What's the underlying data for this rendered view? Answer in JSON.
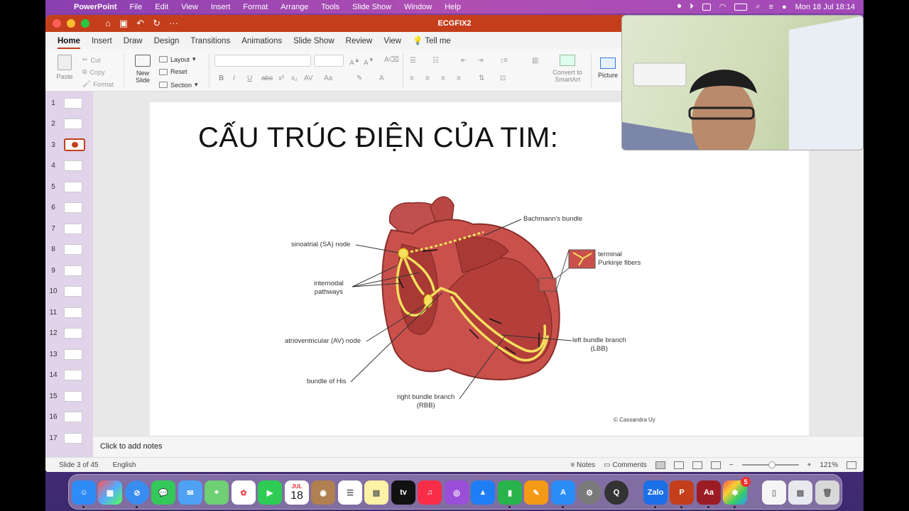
{
  "menubar": {
    "app_name": "PowerPoint",
    "items": [
      "File",
      "Edit",
      "View",
      "Insert",
      "Format",
      "Arrange",
      "Tools",
      "Slide Show",
      "Window",
      "Help"
    ],
    "clock": "Mon 18 Jul  18:14"
  },
  "window": {
    "title": "ECGFIX2",
    "tabs": [
      "Home",
      "Insert",
      "Draw",
      "Design",
      "Transitions",
      "Animations",
      "Slide Show",
      "Review",
      "View"
    ],
    "active_tab": "Home",
    "tell_me": "Tell me"
  },
  "ribbon": {
    "paste": "Paste",
    "cut": "Cut",
    "copy": "Copy",
    "format": "Format",
    "new_slide": "New\nSlide",
    "layout": "Layout",
    "reset": "Reset",
    "section": "Section",
    "convert_smartart": "Convert to\nSmartArt",
    "picture": "Picture"
  },
  "thumbnails": [
    {
      "num": "1"
    },
    {
      "num": "2"
    },
    {
      "num": "3",
      "selected": true
    },
    {
      "num": "4"
    },
    {
      "num": "5"
    },
    {
      "num": "6"
    },
    {
      "num": "7"
    },
    {
      "num": "8"
    },
    {
      "num": "9"
    },
    {
      "num": "10"
    },
    {
      "num": "11"
    },
    {
      "num": "12"
    },
    {
      "num": "13"
    },
    {
      "num": "14"
    },
    {
      "num": "15"
    },
    {
      "num": "16"
    },
    {
      "num": "17"
    }
  ],
  "slide": {
    "title": "CẤU TRÚC ĐIỆN CỦA TIM:",
    "labels": {
      "bachmann": "Bachmann's bundle",
      "sa_node": "sinoatrial (SA) node",
      "internodal": "internodal\npathways",
      "terminal": "terminal\nPurkinje fibers",
      "av_node": "atrioventricular (AV) node",
      "lbb": "left bundle branch\n(LBB)",
      "his": "bundle of His",
      "rbb": "right bundle branch\n(RBB)"
    },
    "credit": "© Cassandra Uy"
  },
  "notes": "Click to add notes",
  "status": {
    "slide": "Slide 3 of 45",
    "language": "English",
    "notes_btn": "Notes",
    "comments_btn": "Comments",
    "zoom": "121%"
  },
  "dock": {
    "calendar_month": "JUL",
    "calendar_day": "18",
    "apple_tv": "tv",
    "zalo": "Zalo",
    "dictionary": "Aa",
    "badge": "5"
  }
}
